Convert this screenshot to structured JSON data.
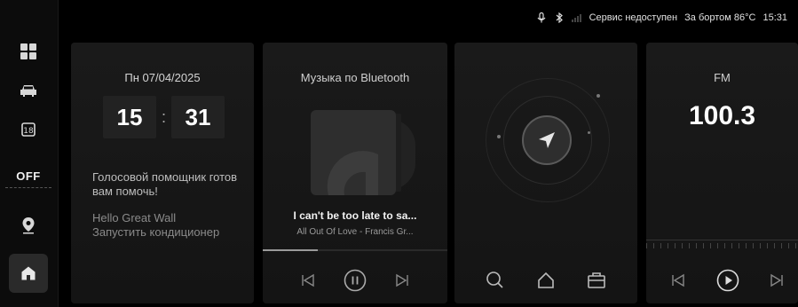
{
  "status_bar": {
    "service": "Сервис недоступен",
    "outside_temp": "За бортом 86°C",
    "time": "15:31"
  },
  "sidebar": {
    "items": [
      {
        "name": "apps",
        "icon": "grid-icon"
      },
      {
        "name": "car",
        "icon": "car-icon"
      },
      {
        "name": "climate",
        "icon": "climate-icon"
      },
      {
        "name": "ac",
        "label": "OFF"
      },
      {
        "name": "navigation",
        "icon": "map-pin-icon"
      },
      {
        "name": "home",
        "icon": "home-icon"
      }
    ]
  },
  "time_card": {
    "date": "Пн 07/04/2025",
    "hours": "15",
    "minutes": "31",
    "assistant_line": "Голосовой помощник готов вам помочь!",
    "assistant_hint": "Hello Great Wall Запустить кондиционер"
  },
  "music_card": {
    "title": "Музыка по Bluetooth",
    "song": "I can't be too late to sa...",
    "artist": "All Out Of Love - Francis Gr...",
    "progress": 0.3
  },
  "fm_card": {
    "title": "FM",
    "frequency": "100.3"
  },
  "colors": {
    "background": "#000000",
    "card": "#1a1a1a",
    "text": "#e8e8e8"
  }
}
